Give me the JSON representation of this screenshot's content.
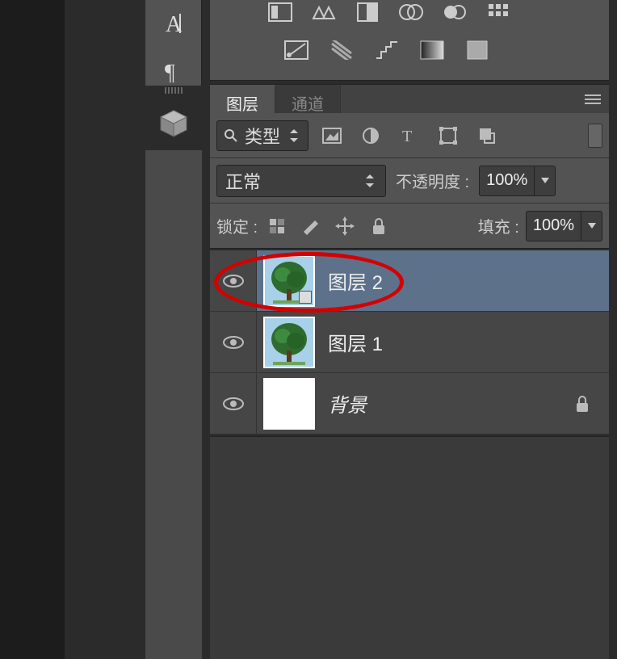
{
  "left_tools": {
    "text_tool": "A",
    "paragraph_tool": "¶"
  },
  "tabs": {
    "layers": "图层",
    "channels": "通道"
  },
  "filter": {
    "type_label": "类型"
  },
  "blend": {
    "mode": "正常",
    "opacity_label": "不透明度 :",
    "opacity_value": "100%"
  },
  "lock": {
    "label": "锁定 :",
    "fill_label": "填充 :",
    "fill_value": "100%"
  },
  "layers": [
    {
      "name": "图层 2",
      "selected": true,
      "visible": true,
      "thumb": "tree",
      "smart": true
    },
    {
      "name": "图层 1",
      "selected": false,
      "visible": true,
      "thumb": "tree",
      "smart": false
    },
    {
      "name": "背景",
      "selected": false,
      "visible": true,
      "thumb": "blank",
      "smart": false,
      "locked": true
    }
  ],
  "annotation": {
    "circled_layer_index": 0
  }
}
